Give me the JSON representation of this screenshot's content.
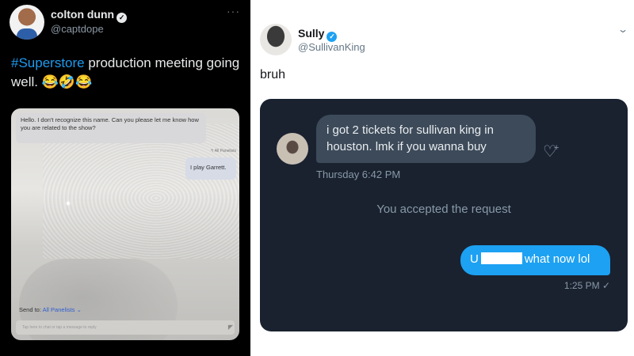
{
  "left_tweet": {
    "author": "colton dunn",
    "handle": "@captdope",
    "more_icon": "more-horizontal-icon",
    "hashtag": "#Superstore",
    "text_after_hashtag": " production meeting going well. ",
    "emojis": "😂🤣😂",
    "photo": {
      "incoming_message": "Hello. I don't recognize this name. Can you please let me know how you are related to the show?",
      "recipient_tag": "All Panelists",
      "outgoing_message": "I play Garrett.",
      "send_to_label": "Send to:",
      "send_to_value": "All Panelists",
      "compose_placeholder": "Tap here to chat or tap a message to reply"
    }
  },
  "right_tweet": {
    "author": "Sully",
    "handle": "@SullivanKing",
    "text": "bruh",
    "dm": {
      "incoming_message": "i got 2 tickets for sullivan king in houston. lmk if you wanna buy",
      "incoming_time": "Thursday 6:42 PM",
      "system_message": "You accepted the request",
      "outgoing_prefix": "U",
      "outgoing_suffix": "what now lol",
      "outgoing_time": "1:25 PM ✓"
    }
  },
  "colors": {
    "link_blue": "#1d9bf0",
    "dm_background": "#1a2230",
    "outgoing_bubble": "#1da1f2"
  }
}
